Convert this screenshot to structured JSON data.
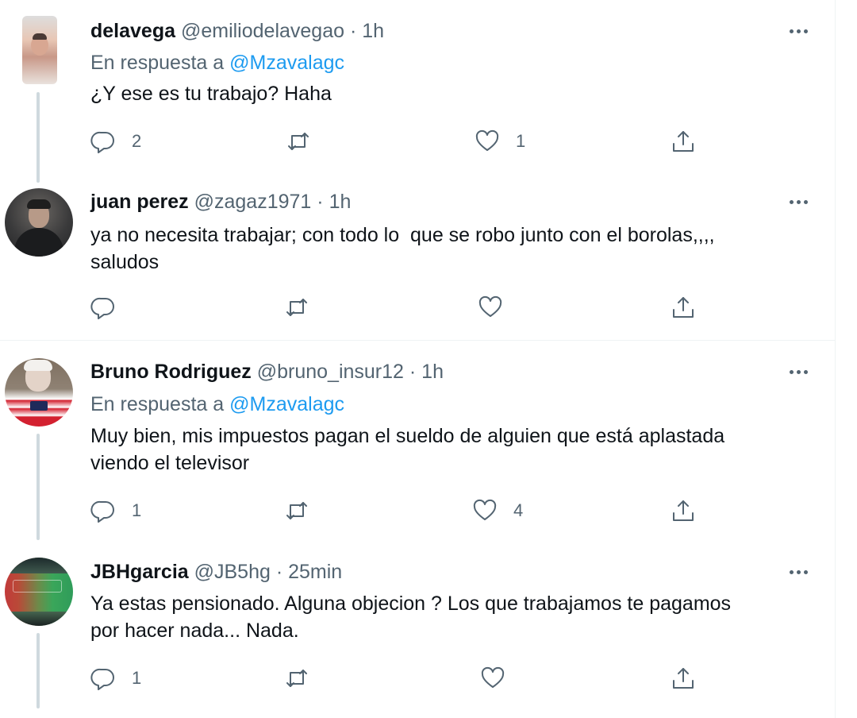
{
  "tweets": [
    {
      "name": "delavega",
      "handle": "@emiliodelavegao",
      "time": "1h",
      "reply_prefix": "En respuesta a",
      "reply_to": "@Mzavalagc",
      "text": "¿Y ese es tu trabajo? Haha",
      "replies": "2",
      "retweets": "",
      "likes": "1"
    },
    {
      "name": "juan perez",
      "handle": "@zagaz1971",
      "time": "1h",
      "text": "ya no necesita trabajar; con todo lo  que se robo junto con el borolas,,,,\nsaludos",
      "replies": "",
      "retweets": "",
      "likes": ""
    },
    {
      "name": "Bruno Rodriguez",
      "handle": "@bruno_insur12",
      "time": "1h",
      "reply_prefix": "En respuesta a",
      "reply_to": "@Mzavalagc",
      "text": "Muy bien, mis impuestos pagan el sueldo de alguien que está aplastada\nviendo el televisor",
      "replies": "1",
      "retweets": "",
      "likes": "4"
    },
    {
      "name": "JBHgarcia",
      "handle": "@JB5hg",
      "time": "25min",
      "text": "Ya estas pensionado. Alguna objecion ? Los que trabajamos te pagamos\npor hacer nada... Nada.",
      "replies": "1",
      "retweets": "",
      "likes": ""
    }
  ],
  "separator": "·",
  "icons": {
    "reply": "reply-icon",
    "retweet": "retweet-icon",
    "like": "heart-icon",
    "share": "share-icon",
    "more": "more-icon"
  },
  "colors": {
    "link": "#1d9bf0",
    "secondary": "#536471",
    "thread_line": "#cfd9de",
    "divider": "#eff3f4"
  }
}
